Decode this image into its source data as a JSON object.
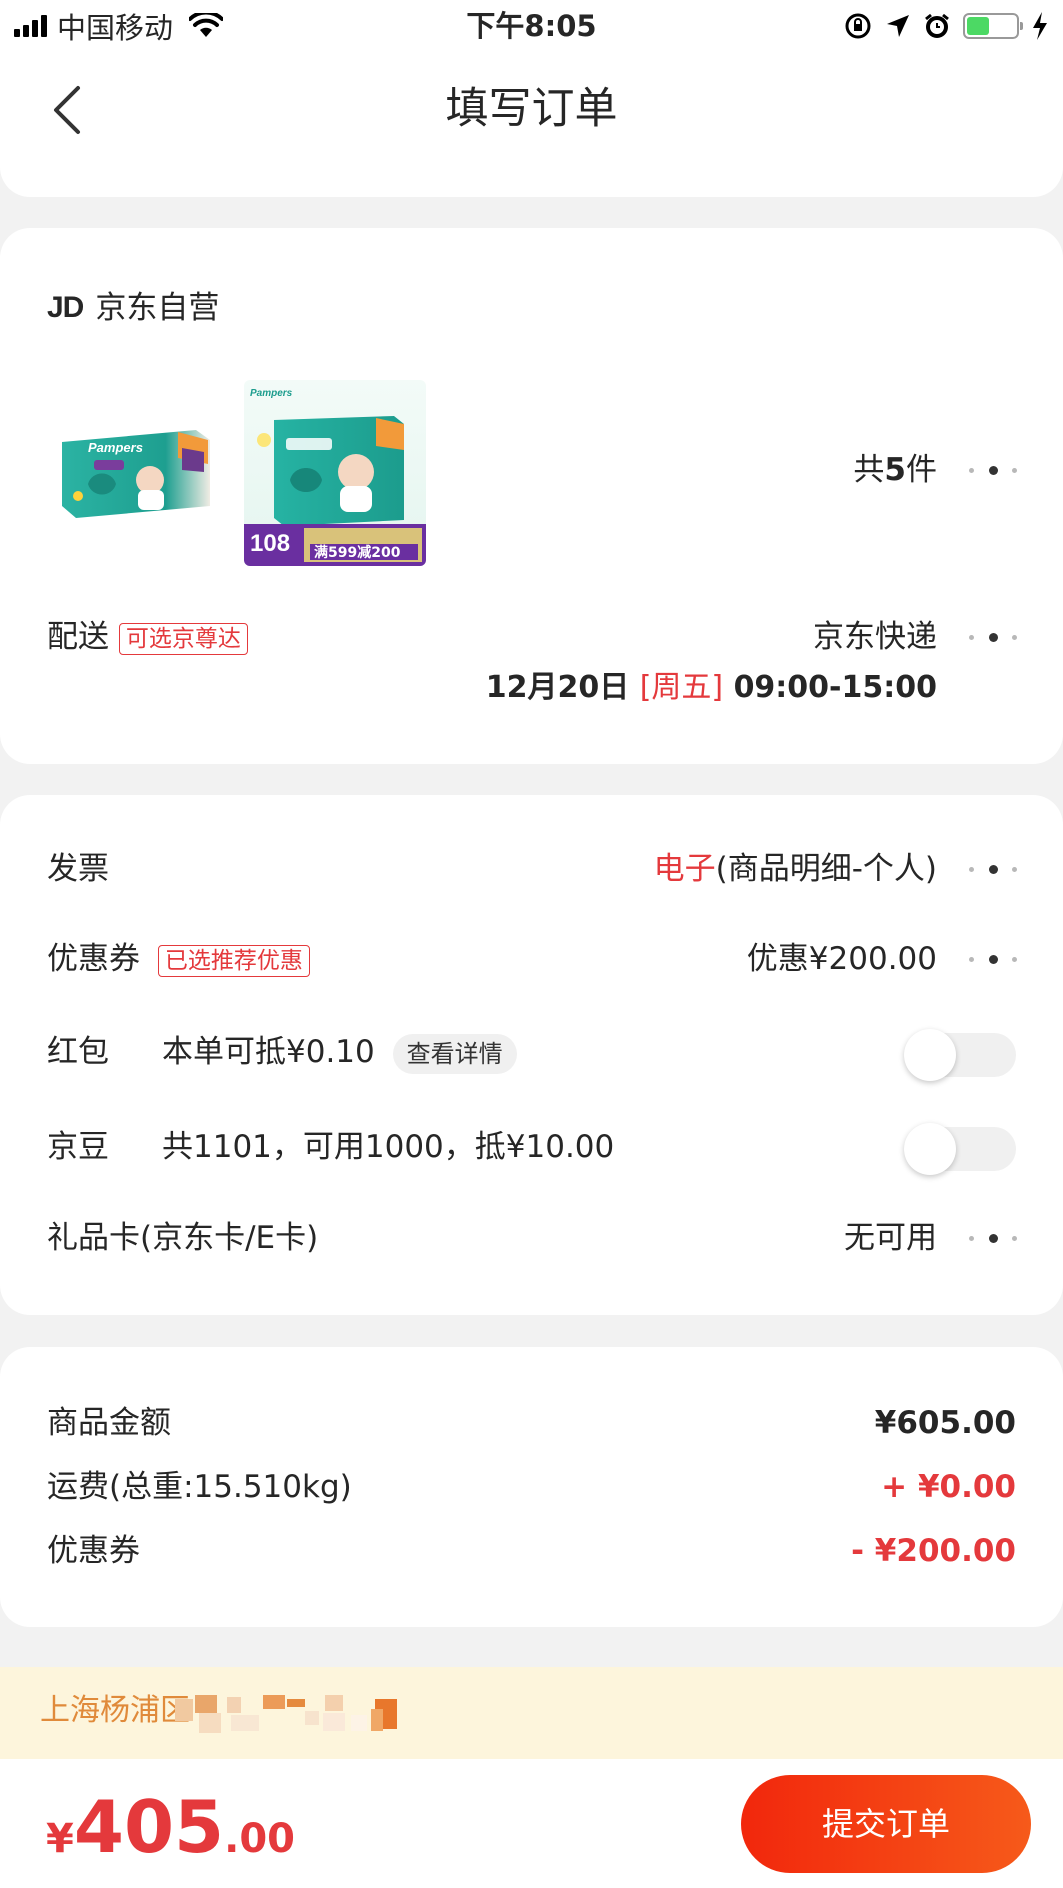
{
  "status_bar": {
    "carrier": "中国移动",
    "time": "下午8:05",
    "battery_level": 0.45
  },
  "nav": {
    "title": "填写订单"
  },
  "shop": {
    "logo": "JD",
    "name": "京东自营",
    "count_prefix": "共",
    "count": "5",
    "count_suffix": "件",
    "product2_badge_num": "108",
    "product2_promo": "满599减200"
  },
  "delivery": {
    "label": "配送",
    "tag": "可选京尊达",
    "method": "京东快递",
    "date": "12月20日",
    "weekday": "[周五]",
    "time_range": "09:00-15:00"
  },
  "invoice": {
    "label": "发票",
    "type": "电子",
    "detail": "(商品明细-个人)"
  },
  "coupon": {
    "label": "优惠券",
    "tag": "已选推荐优惠",
    "value": "优惠¥200.00"
  },
  "redpacket": {
    "label": "红包",
    "desc": "本单可抵¥0.10",
    "detail_btn": "查看详情",
    "enabled": false
  },
  "jingdou": {
    "label": "京豆",
    "desc": "共1101，可用1000，抵¥10.00",
    "enabled": false
  },
  "giftcard": {
    "label": "礼品卡(京东卡/E卡)",
    "value": "无可用"
  },
  "summary": {
    "goods_label": "商品金额",
    "goods_value": "¥605.00",
    "freight_label": "运费(总重:15.510kg)",
    "freight_value": "+ ¥0.00",
    "coupon_label": "优惠券",
    "coupon_value": "- ¥200.00"
  },
  "address": {
    "text": "上海杨浦区"
  },
  "bottom": {
    "currency": "¥",
    "total_int": "405",
    "total_dec": ".00",
    "submit": "提交订单"
  },
  "colors": {
    "accent_red": "#e4393c",
    "button_gradient_start": "#f2270c",
    "button_gradient_end": "#f65a1a",
    "address_bg": "#fdf5dc"
  }
}
